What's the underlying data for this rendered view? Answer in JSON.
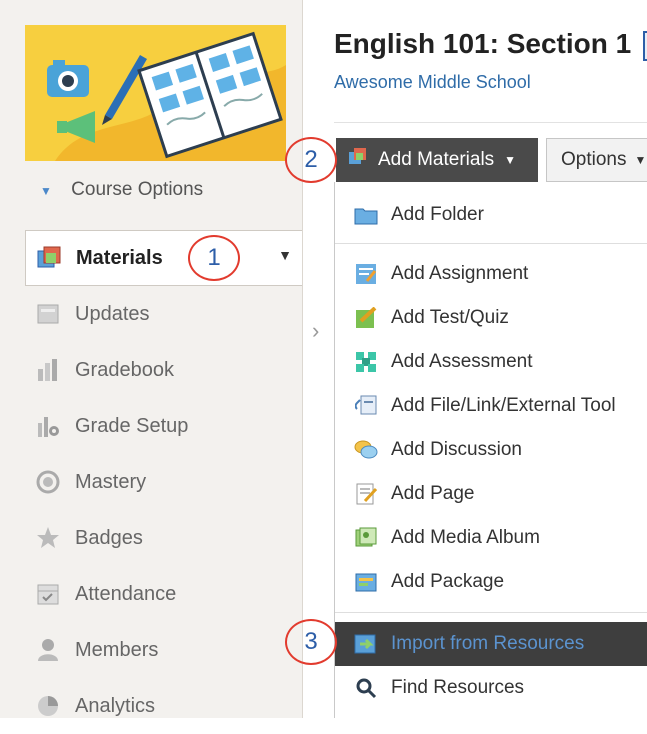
{
  "header": {
    "title": "English 101: Section 1",
    "school": "Awesome Middle School"
  },
  "sidebar": {
    "course_options": "Course Options",
    "items": [
      {
        "label": "Materials",
        "icon": "materials-icon",
        "active": true
      },
      {
        "label": "Updates",
        "icon": "updates-icon"
      },
      {
        "label": "Gradebook",
        "icon": "gradebook-icon"
      },
      {
        "label": "Grade Setup",
        "icon": "grade-setup-icon"
      },
      {
        "label": "Mastery",
        "icon": "mastery-icon"
      },
      {
        "label": "Badges",
        "icon": "badges-icon"
      },
      {
        "label": "Attendance",
        "icon": "attendance-icon"
      },
      {
        "label": "Members",
        "icon": "members-icon"
      },
      {
        "label": "Analytics",
        "icon": "analytics-icon"
      }
    ]
  },
  "toolbar": {
    "add_materials": "Add Materials",
    "options": "Options"
  },
  "menu": {
    "items": [
      {
        "label": "Add Folder",
        "icon": "folder-icon"
      },
      {
        "label": "Add Assignment",
        "icon": "assignment-icon"
      },
      {
        "label": "Add Test/Quiz",
        "icon": "test-quiz-icon"
      },
      {
        "label": "Add Assessment",
        "icon": "assessment-icon"
      },
      {
        "label": "Add File/Link/External Tool",
        "icon": "file-link-icon"
      },
      {
        "label": "Add Discussion",
        "icon": "discussion-icon"
      },
      {
        "label": "Add Page",
        "icon": "page-icon"
      },
      {
        "label": "Add Media Album",
        "icon": "media-album-icon"
      },
      {
        "label": "Add Package",
        "icon": "package-icon"
      },
      {
        "label": "Import from Resources",
        "icon": "import-icon"
      },
      {
        "label": "Find Resources",
        "icon": "find-icon"
      }
    ]
  },
  "callouts": [
    "1",
    "2",
    "3"
  ],
  "colors": {
    "accent_blue": "#2f6ca8",
    "highlight_bg": "#3e3e3e",
    "callout_red": "#e23b2e",
    "sidebar_bg": "#f3f1ee"
  }
}
